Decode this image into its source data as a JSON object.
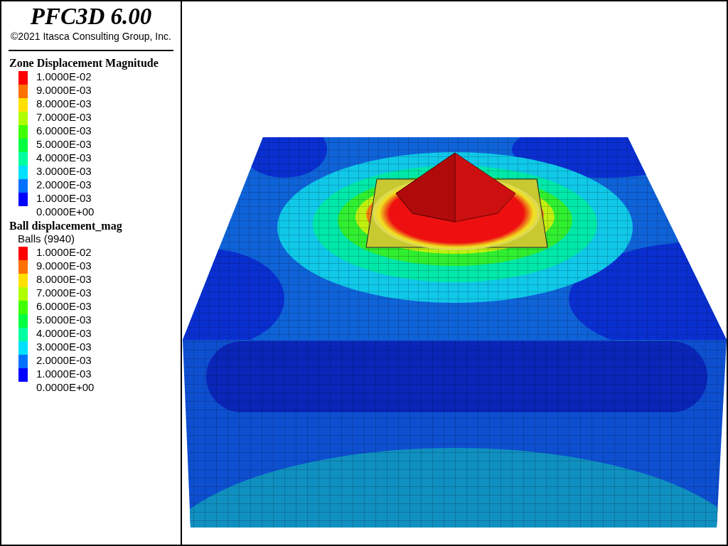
{
  "title": "PFC3D 6.00",
  "copyright": "©2021 Itasca Consulting Group, Inc.",
  "legends": [
    {
      "title": "Zone Displacement Magnitude",
      "bands": [
        {
          "color": "#ff0000"
        },
        {
          "color": "#ff7000"
        },
        {
          "color": "#ffe000"
        },
        {
          "color": "#b0ff00"
        },
        {
          "color": "#40ff00"
        },
        {
          "color": "#00ff40"
        },
        {
          "color": "#00ffa0"
        },
        {
          "color": "#00e0ff"
        },
        {
          "color": "#0070ff"
        },
        {
          "color": "#0000ff"
        }
      ],
      "labels": [
        "1.0000E-02",
        "9.0000E-03",
        "8.0000E-03",
        "7.0000E-03",
        "6.0000E-03",
        "5.0000E-03",
        "4.0000E-03",
        "3.0000E-03",
        "2.0000E-03",
        "1.0000E-03",
        "0.0000E+00"
      ]
    },
    {
      "title": "Ball displacement_mag",
      "subtitle": "Balls (9940)",
      "bands": [
        {
          "color": "#ff0000"
        },
        {
          "color": "#ff7000"
        },
        {
          "color": "#ffe000"
        },
        {
          "color": "#b0ff00"
        },
        {
          "color": "#40ff00"
        },
        {
          "color": "#00ff40"
        },
        {
          "color": "#00ffa0"
        },
        {
          "color": "#00e0ff"
        },
        {
          "color": "#0070ff"
        },
        {
          "color": "#0000ff"
        }
      ],
      "labels": [
        "1.0000E-02",
        "9.0000E-03",
        "8.0000E-03",
        "7.0000E-03",
        "6.0000E-03",
        "5.0000E-03",
        "4.0000E-03",
        "3.0000E-03",
        "2.0000E-03",
        "1.0000E-03",
        "0.0000E+00"
      ]
    }
  ]
}
